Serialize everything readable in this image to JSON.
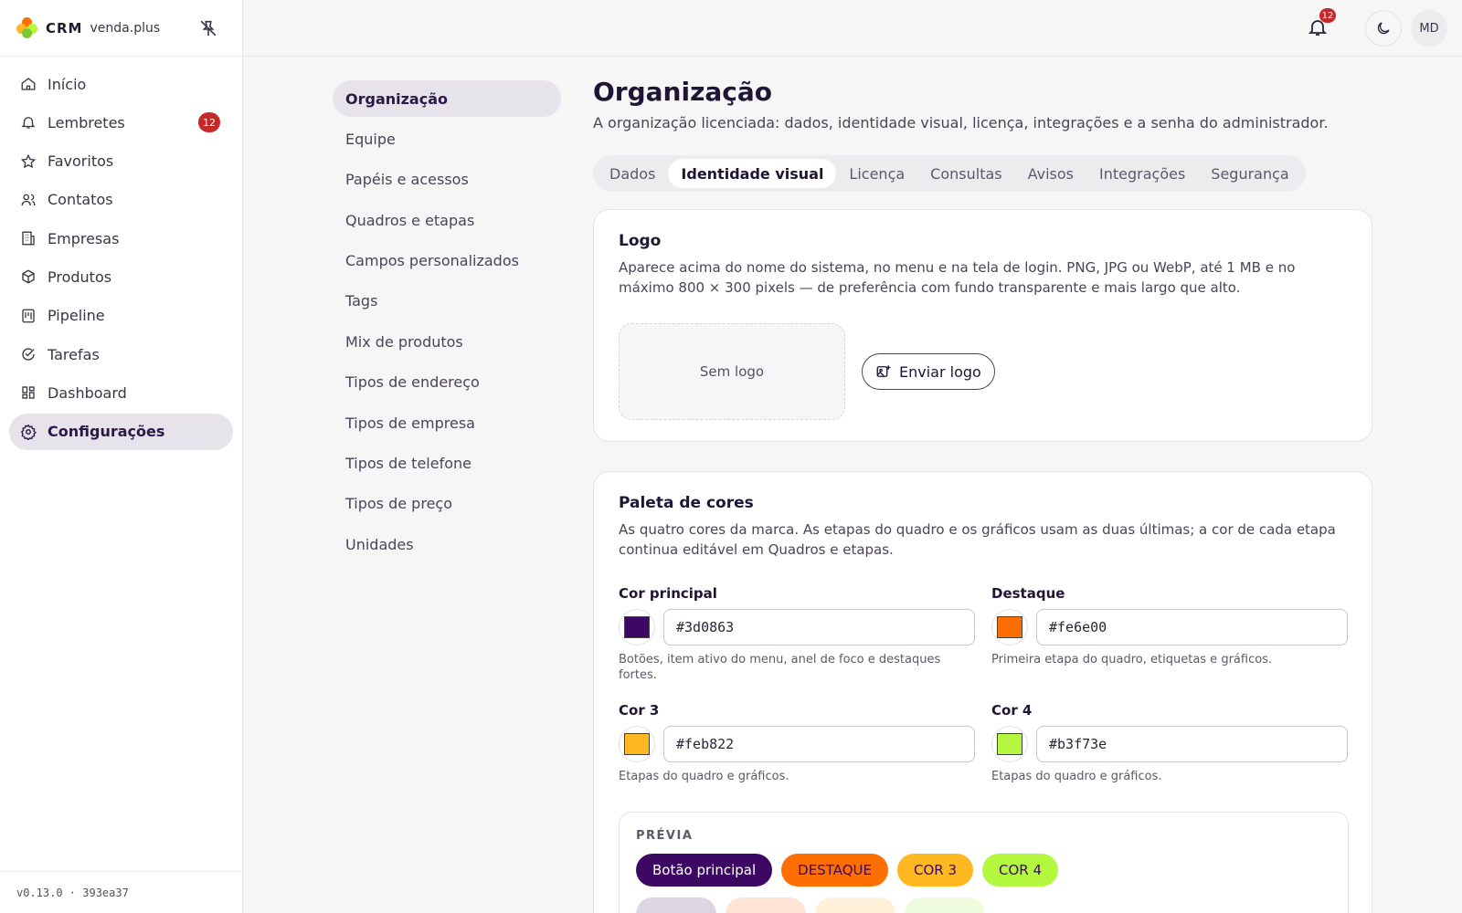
{
  "brand": {
    "crm": "CRM",
    "name": "venda.plus"
  },
  "sidebar": {
    "items": [
      {
        "label": "Início",
        "icon": "home-icon"
      },
      {
        "label": "Lembretes",
        "icon": "bell-icon",
        "badge": "12"
      },
      {
        "label": "Favoritos",
        "icon": "star-icon"
      },
      {
        "label": "Contatos",
        "icon": "users-icon"
      },
      {
        "label": "Empresas",
        "icon": "building-icon"
      },
      {
        "label": "Produtos",
        "icon": "box-icon"
      },
      {
        "label": "Pipeline",
        "icon": "kanban-icon"
      },
      {
        "label": "Tarefas",
        "icon": "check-circle-icon"
      },
      {
        "label": "Dashboard",
        "icon": "dashboard-icon"
      },
      {
        "label": "Configurações",
        "icon": "gear-icon",
        "active": true
      }
    ],
    "version": "v0.13.0 · 393ea37"
  },
  "topbar": {
    "notifications": "12",
    "avatar": "MD"
  },
  "submenu": {
    "items": [
      "Organização",
      "Equipe",
      "Papéis e acessos",
      "Quadros e etapas",
      "Campos personalizados",
      "Tags",
      "Mix de produtos",
      "Tipos de endereço",
      "Tipos de empresa",
      "Tipos de telefone",
      "Tipos de preço",
      "Unidades"
    ]
  },
  "main": {
    "title": "Organização",
    "subtitle": "A organização licenciada: dados, identidade visual, licença, integrações e a senha do administrador.",
    "tabs": [
      "Dados",
      "Identidade visual",
      "Licença",
      "Consultas",
      "Avisos",
      "Integrações",
      "Segurança"
    ],
    "active_tab": "Identidade visual"
  },
  "logo_card": {
    "title": "Logo",
    "description": "Aparece acima do nome do sistema, no menu e na tela de login. PNG, JPG ou WebP, até 1 MB e no máximo 800 × 300 pixels — de preferência com fundo transparente e mais largo que alto.",
    "empty": "Sem logo",
    "upload": "Enviar logo"
  },
  "palette_card": {
    "title": "Paleta de cores",
    "description": "As quatro cores da marca. As etapas do quadro e os gráficos usam as duas últimas; a cor de cada etapa continua editável em Quadros e etapas.",
    "colors": [
      {
        "label": "Cor principal",
        "value": "#3d0863",
        "hint": "Botões, item ativo do menu, anel de foco e destaques fortes."
      },
      {
        "label": "Destaque",
        "value": "#fe6e00",
        "hint": "Primeira etapa do quadro, etiquetas e gráficos."
      },
      {
        "label": "Cor 3",
        "value": "#feb822",
        "hint": "Etapas do quadro e gráficos."
      },
      {
        "label": "Cor 4",
        "value": "#b3f73e",
        "hint": "Etapas do quadro e gráficos."
      }
    ],
    "preview": {
      "label": "PRÉVIA",
      "chips": [
        "Botão principal",
        "DESTAQUE",
        "COR 3",
        "COR 4"
      ]
    }
  }
}
